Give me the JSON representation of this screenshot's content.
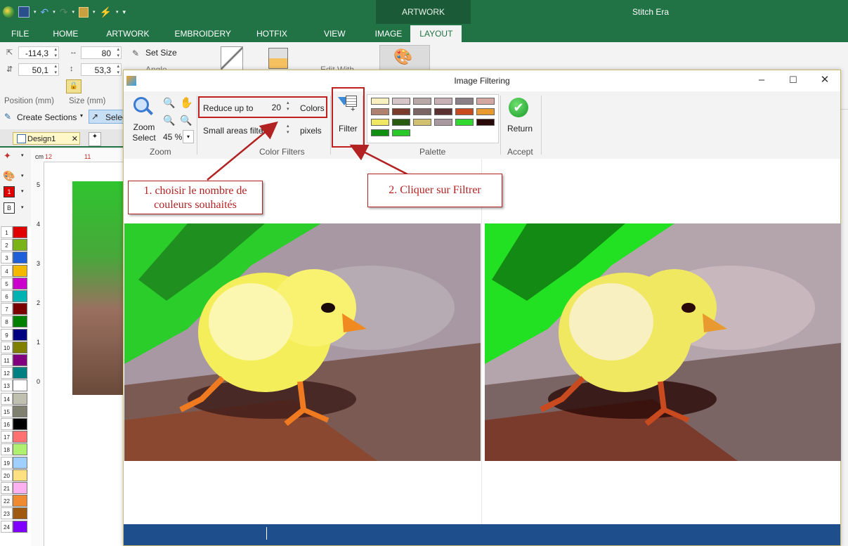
{
  "app": {
    "title": "Stitch Era",
    "context_tab": "ARTWORK",
    "tabs": [
      "FILE",
      "HOME",
      "ARTWORK",
      "EMBROIDERY",
      "HOTFIX",
      "VIEW",
      "IMAGE",
      "LAYOUT"
    ],
    "active_tab": "LAYOUT"
  },
  "ribbon": {
    "pos_x": "-114,3",
    "pos_y": "50,1",
    "size_w": "80",
    "size_h": "53,3",
    "position_label": "Position (mm)",
    "size_label": "Size (mm)",
    "set_size": "Set Size",
    "angle": "Angle",
    "edit_with": "Edit With",
    "create_sections": "Create Sections",
    "select": "Selec"
  },
  "document": {
    "tab": "Design1",
    "ruler_unit": "cm",
    "hruler_ticks": [
      "12",
      "11"
    ],
    "vruler_ticks": [
      "5",
      "4",
      "3",
      "2",
      "1",
      "0"
    ]
  },
  "left_colors": {
    "active_index": "1",
    "b_label": "B",
    "items": [
      {
        "n": "1",
        "c": "#e00000"
      },
      {
        "n": "2",
        "c": "#7ab317"
      },
      {
        "n": "3",
        "c": "#1f5fd8"
      },
      {
        "n": "4",
        "c": "#f5b800"
      },
      {
        "n": "5",
        "c": "#cc00cc"
      },
      {
        "n": "6",
        "c": "#00b3b3"
      },
      {
        "n": "7",
        "c": "#7a0000"
      },
      {
        "n": "8",
        "c": "#008000"
      },
      {
        "n": "9",
        "c": "#000080"
      },
      {
        "n": "10",
        "c": "#808000"
      },
      {
        "n": "11",
        "c": "#800080"
      },
      {
        "n": "12",
        "c": "#008080"
      },
      {
        "n": "13",
        "c": "#ffffff"
      },
      {
        "n": "14",
        "c": "#c0c0b0"
      },
      {
        "n": "15",
        "c": "#808070"
      },
      {
        "n": "16",
        "c": "#000000"
      },
      {
        "n": "17",
        "c": "#ff7070"
      },
      {
        "n": "18",
        "c": "#b0f070"
      },
      {
        "n": "19",
        "c": "#a0d0ff"
      },
      {
        "n": "20",
        "c": "#ffe080"
      },
      {
        "n": "21",
        "c": "#ffb0f0"
      },
      {
        "n": "22",
        "c": "#f08a30"
      },
      {
        "n": "23",
        "c": "#a05a10"
      },
      {
        "n": "24",
        "c": "#8000ff"
      }
    ]
  },
  "dialog": {
    "title": "Image Filtering",
    "zoom": {
      "button": "Zoom Select",
      "percent": "45 %",
      "group": "Zoom"
    },
    "filters": {
      "reduce_label": "Reduce up to",
      "reduce_value": "20",
      "colors_label": "Colors",
      "small_label": "Small areas filter",
      "small_value": "0",
      "pixels_label": "pixels",
      "group": "Color Filters"
    },
    "filter_button": "Filter",
    "palette": {
      "group": "Palette",
      "colors": [
        "#f8f0c0",
        "#d6c6c8",
        "#b8a8a8",
        "#c8b0b4",
        "#8a8088",
        "#d4a8a0",
        "#b08070",
        "#7a3a2c",
        "#7a6464",
        "#5a3030",
        "#c84a1e",
        "#e89a30",
        "#f0e860",
        "#2a5a10",
        "#d0c070",
        "#a898a0",
        "#30d830",
        "#2a0a08",
        "#109010",
        "#28c828"
      ]
    },
    "accept": {
      "button": "Return",
      "group": "Accept"
    }
  },
  "callouts": {
    "step1": "1. choisir le nombre de couleurs souhaités",
    "step2": "2. Cliquer sur Filtrer"
  }
}
